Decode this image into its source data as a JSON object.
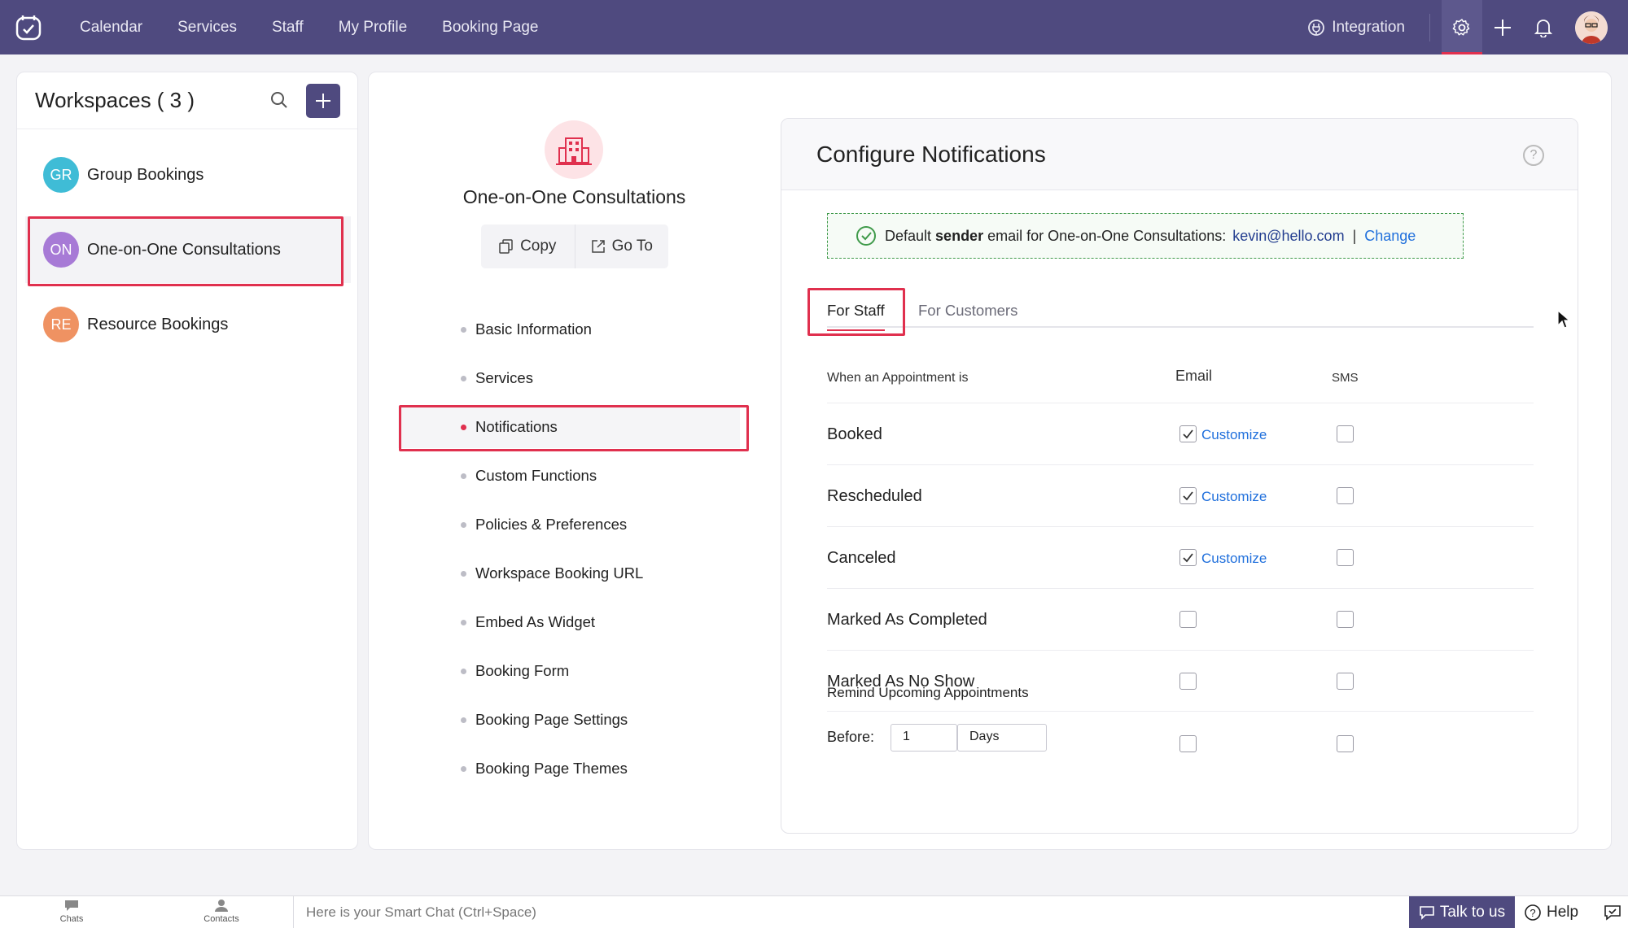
{
  "topbar": {
    "nav": [
      "Calendar",
      "Services",
      "Staff",
      "My Profile",
      "Booking Page"
    ],
    "integration_label": "Integration"
  },
  "workspaces": {
    "title": "Workspaces ( 3 )",
    "items": [
      {
        "initials": "GR",
        "name": "Group Bookings",
        "color": "#3fbcd6"
      },
      {
        "initials": "ON",
        "name": "One-on-One Consultations",
        "color": "#a77ad6"
      },
      {
        "initials": "RE",
        "name": "Resource Bookings",
        "color": "#ef9262"
      }
    ]
  },
  "workspace": {
    "name": "One-on-One Consultations",
    "copy_label": "Copy",
    "goto_label": "Go To"
  },
  "menu": [
    "Basic Information",
    "Services",
    "Notifications",
    "Custom Functions",
    "Policies & Preferences",
    "Workspace Booking URL",
    "Embed As Widget",
    "Booking Form",
    "Booking Page Settings",
    "Booking Page Themes"
  ],
  "config": {
    "title": "Configure Notifications",
    "sender": {
      "prefix": "Default",
      "bold": "sender",
      "suffix": "email for One-on-One Consultations:",
      "email": "kevin@hello.com",
      "change": "Change"
    },
    "tabs": [
      "For Staff",
      "For Customers"
    ],
    "headers": {
      "event": "When an Appointment is",
      "email": "Email",
      "sms": "SMS"
    },
    "rows": [
      {
        "label": "Booked",
        "email": true,
        "customize": "Customize",
        "sms": false
      },
      {
        "label": "Rescheduled",
        "email": true,
        "customize": "Customize",
        "sms": false
      },
      {
        "label": "Canceled",
        "email": true,
        "customize": "Customize",
        "sms": false
      },
      {
        "label": "Marked As Completed",
        "email": false,
        "customize": "",
        "sms": false
      },
      {
        "label": "Marked As No Show",
        "email": false,
        "customize": "",
        "sms": false
      }
    ],
    "remind_label": "Remind Upcoming Appointments",
    "before_label": "Before:",
    "before_value": "1",
    "before_unit": "Days"
  },
  "bottombar": {
    "chats": "Chats",
    "contacts": "Contacts",
    "smartchat_placeholder": "Here is your Smart Chat (Ctrl+Space)",
    "talk": "Talk to us",
    "help": "Help"
  }
}
